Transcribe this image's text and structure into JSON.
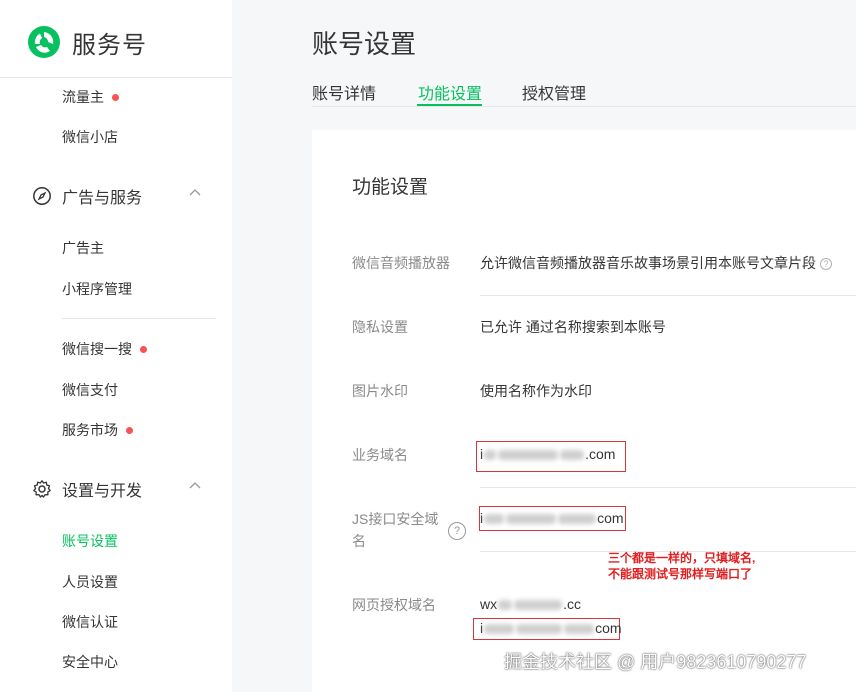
{
  "app": {
    "name": "服务号",
    "brand_color": "#07c160"
  },
  "sidebar": {
    "items_top": [
      {
        "label": "流量主",
        "badge_dot": true
      },
      {
        "label": "微信小店",
        "badge_dot": false
      }
    ],
    "group_ads": {
      "label": "广告与服务",
      "icon": "compass-icon",
      "items": [
        {
          "label": "广告主",
          "badge_dot": false
        },
        {
          "label": "小程序管理",
          "badge_dot": false
        },
        {
          "label": "微信搜一搜",
          "badge_dot": true
        },
        {
          "label": "微信支付",
          "badge_dot": false
        },
        {
          "label": "服务市场",
          "badge_dot": true
        }
      ]
    },
    "group_settings": {
      "label": "设置与开发",
      "icon": "gear-icon",
      "items": [
        {
          "label": "账号设置",
          "active": true
        },
        {
          "label": "人员设置"
        },
        {
          "label": "微信认证"
        },
        {
          "label": "安全中心"
        }
      ]
    }
  },
  "page": {
    "title": "账号设置",
    "tabs": [
      {
        "label": "账号详情"
      },
      {
        "label": "功能设置",
        "active": true
      },
      {
        "label": "授权管理"
      }
    ]
  },
  "panel": {
    "title": "功能设置",
    "rows": [
      {
        "label": "微信音频播放器",
        "value": "允许微信音频播放器音乐故事场景引用本账号文章片段"
      },
      {
        "label": "隐私设置",
        "value": "已允许 通过名称搜索到本账号"
      },
      {
        "label": "图片水印",
        "value": "使用名称作为水印"
      },
      {
        "label": "业务域名",
        "value_prefix": "i",
        "value_suffix": ".com"
      },
      {
        "label": "JS接口安全域名",
        "value_prefix": "i",
        "value_suffix": "com"
      },
      {
        "label": "网页授权域名",
        "value_line1_prefix": "wx",
        "value_line1_suffix": ".cc",
        "value_line2_prefix": "i",
        "value_line2_suffix": "com"
      }
    ],
    "help_symbol": "?"
  },
  "annotation": {
    "line1": "三个都是一样的，只填域名,",
    "line2": "不能跟测试号那样写端口了"
  },
  "watermark": "掘金技术社区 @ 用户9823610790277"
}
